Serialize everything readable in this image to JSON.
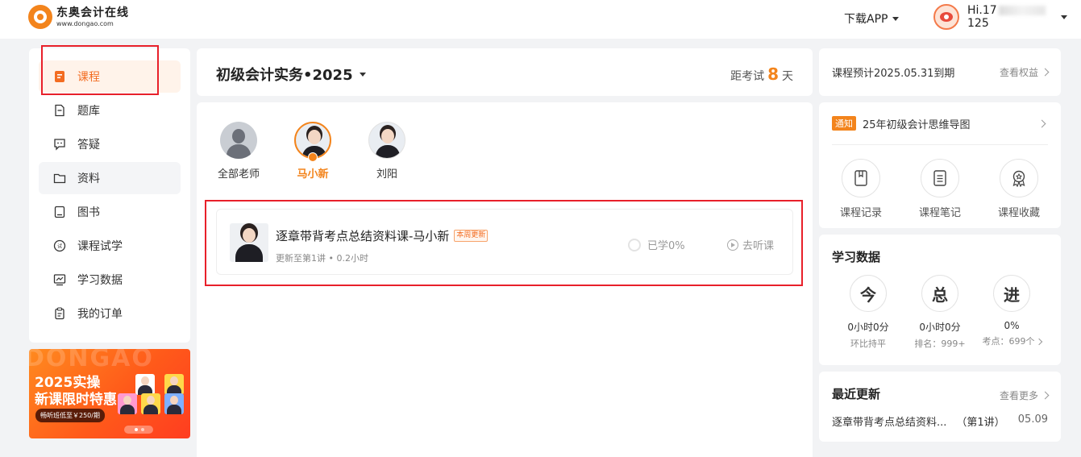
{
  "header": {
    "logo_name": "东奥会计在线",
    "logo_url": "www.dongao.com",
    "download_label": "下载APP",
    "user_prefix": "Hi.17",
    "user_suffix": "125"
  },
  "sidebar": {
    "items": [
      {
        "label": "课程",
        "icon": "book-icon",
        "active": true
      },
      {
        "label": "题库",
        "icon": "question-bank-icon"
      },
      {
        "label": "答疑",
        "icon": "qa-icon"
      },
      {
        "label": "资料",
        "icon": "folder-icon",
        "hover": true
      },
      {
        "label": "图书",
        "icon": "notebook-icon"
      },
      {
        "label": "课程试学",
        "icon": "trial-icon"
      },
      {
        "label": "学习数据",
        "icon": "chart-icon"
      },
      {
        "label": "我的订单",
        "icon": "clipboard-icon"
      }
    ]
  },
  "banner": {
    "bg_text": "DONGAO",
    "line1": "2025实操",
    "line2": "新课限时特惠",
    "pill": "畅听班低至￥250/期"
  },
  "main": {
    "subject": "初级会计实务•2025",
    "exam_prefix": "距考试",
    "exam_days": "8",
    "exam_suffix": "天",
    "teachers": [
      {
        "name": "全部老师"
      },
      {
        "name": "马小新",
        "selected": true
      },
      {
        "name": "刘阳"
      }
    ],
    "course": {
      "title": "逐章带背考点总结资料课-马小新",
      "tag": "本周更新",
      "meta": "更新至第1讲 • 0.2小时",
      "progress": "已学0%",
      "listen": "去听课"
    }
  },
  "right": {
    "expiry": "课程预计2025.05.31到期",
    "rights_link": "查看权益",
    "notice_badge": "通知",
    "notice_text": "25年初级会计思维导图",
    "tools": [
      {
        "label": "课程记录",
        "icon": "bookmark-icon"
      },
      {
        "label": "课程笔记",
        "icon": "note-icon"
      },
      {
        "label": "课程收藏",
        "icon": "award-icon"
      }
    ],
    "stats_title": "学习数据",
    "stats": [
      {
        "glyph": "今",
        "value": "0小时0分",
        "sub": "环比持平"
      },
      {
        "glyph": "总",
        "value": "0小时0分",
        "sub": "排名：999+"
      },
      {
        "glyph": "进",
        "value": "0%",
        "sub": "考点：699个"
      }
    ],
    "recent_title": "最近更新",
    "recent_more": "查看更多",
    "recent": {
      "name": "逐章带背考点总结资料...",
      "lesson": "（第1讲）",
      "date": "05.09"
    }
  },
  "colors": {
    "accent": "#f3841c",
    "highlight": "#e8202a"
  }
}
